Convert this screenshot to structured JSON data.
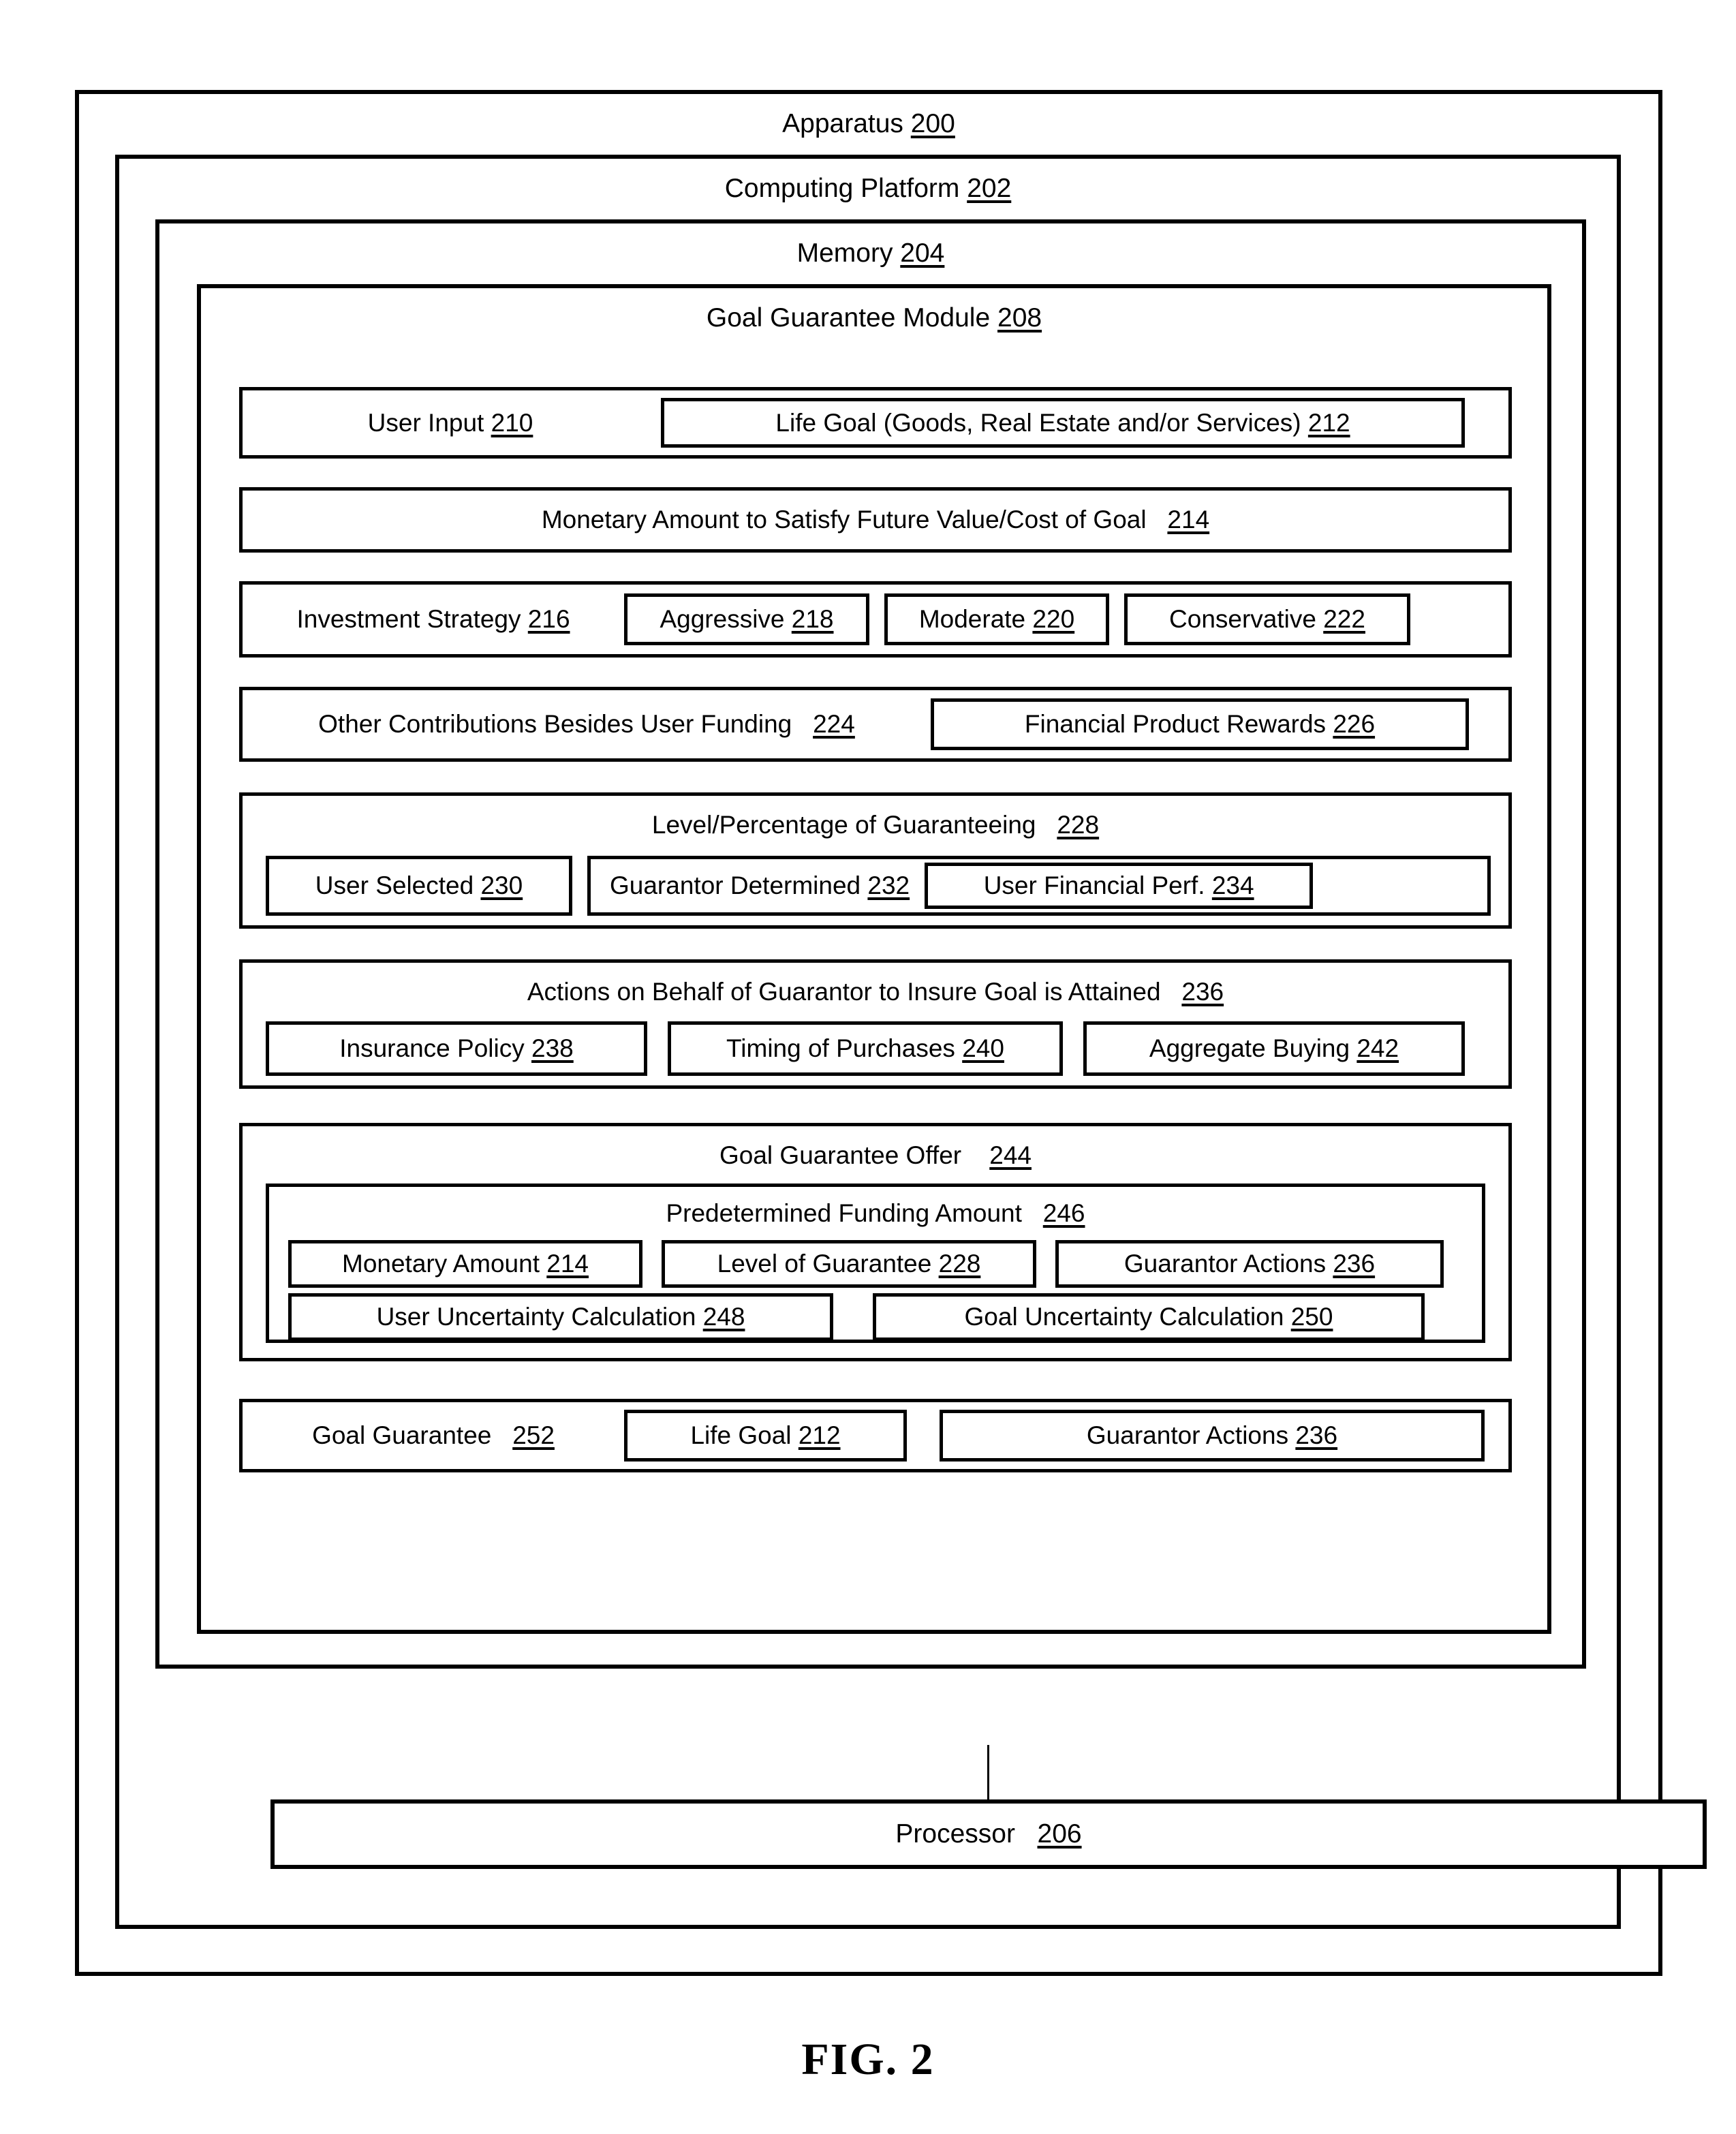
{
  "figure": {
    "caption": "FIG. 2"
  },
  "apparatus": {
    "title": "Apparatus",
    "ref": "200"
  },
  "computing_platform": {
    "title": "Computing Platform",
    "ref": "202"
  },
  "memory": {
    "title": "Memory",
    "ref": "204"
  },
  "processor": {
    "title": "Processor",
    "ref": "206"
  },
  "goal_guarantee_module": {
    "title": "Goal Guarantee Module",
    "ref": "208",
    "rows": {
      "user_input": {
        "label": "User Input",
        "ref": "210",
        "life_goal": {
          "label": "Life Goal (Goods, Real Estate and/or Services)",
          "ref": "212"
        }
      },
      "monetary_amount": {
        "label": "Monetary Amount to Satisfy Future Value/Cost of Goal",
        "ref": "214"
      },
      "investment_strategy": {
        "label": "Investment Strategy",
        "ref": "216",
        "options": [
          {
            "label": "Aggressive",
            "ref": "218"
          },
          {
            "label": "Moderate",
            "ref": "220"
          },
          {
            "label": "Conservative",
            "ref": "222"
          }
        ]
      },
      "other_contributions": {
        "label": "Other Contributions Besides User Funding",
        "ref": "224",
        "rewards": {
          "label": "Financial Product Rewards",
          "ref": "226"
        }
      },
      "level_percentage": {
        "label": "Level/Percentage of Guaranteeing",
        "ref": "228",
        "user_selected": {
          "label": "User Selected",
          "ref": "230"
        },
        "guarantor_determined": {
          "label": "Guarantor Determined",
          "ref": "232"
        },
        "user_financial_perf": {
          "label": "User Financial Perf.",
          "ref": "234"
        }
      },
      "guarantor_actions": {
        "label": "Actions on Behalf of Guarantor to Insure Goal is Attained",
        "ref": "236",
        "items": [
          {
            "label": "Insurance Policy",
            "ref": "238"
          },
          {
            "label": "Timing of Purchases",
            "ref": "240"
          },
          {
            "label": "Aggregate Buying",
            "ref": "242"
          }
        ]
      },
      "goal_guarantee_offer": {
        "label": "Goal Guarantee Offer",
        "ref": "244",
        "predetermined_funding": {
          "label": "Predetermined Funding Amount",
          "ref": "246",
          "tier1": [
            {
              "label": "Monetary Amount",
              "ref": "214"
            },
            {
              "label": "Level of Guarantee",
              "ref": "228"
            },
            {
              "label": "Guarantor Actions",
              "ref": "236"
            }
          ],
          "tier2": [
            {
              "label": "User Uncertainty Calculation",
              "ref": "248"
            },
            {
              "label": "Goal Uncertainty Calculation",
              "ref": "250"
            }
          ]
        }
      },
      "goal_guarantee": {
        "label": "Goal Guarantee",
        "ref": "252",
        "life_goal": {
          "label": "Life Goal",
          "ref": "212"
        },
        "guarantor_actions": {
          "label": "Guarantor Actions",
          "ref": "236"
        }
      }
    }
  }
}
